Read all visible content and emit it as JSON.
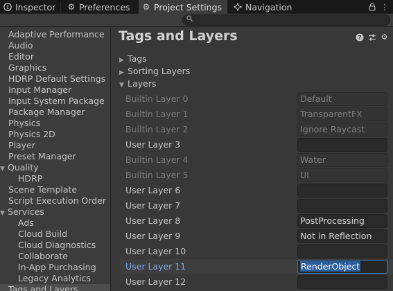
{
  "tabs": [
    {
      "label": "Inspector",
      "icon": "info-icon",
      "active": false
    },
    {
      "label": "Preferences",
      "icon": "gear-icon",
      "active": false
    },
    {
      "label": "Project Settings",
      "icon": "gear-icon",
      "active": true
    },
    {
      "label": "Navigation",
      "icon": "navigation-icon",
      "active": false
    }
  ],
  "window_controls": {
    "menu_glyph": "⋮",
    "lock_glyph": "🔒"
  },
  "search": {
    "value": "",
    "placeholder": ""
  },
  "sidebar": {
    "items": [
      {
        "label": "Adaptive Performance"
      },
      {
        "label": "Audio"
      },
      {
        "label": "Editor"
      },
      {
        "label": "Graphics"
      },
      {
        "label": "HDRP Default Settings"
      },
      {
        "label": "Input Manager"
      },
      {
        "label": "Input System Package"
      },
      {
        "label": "Package Manager"
      },
      {
        "label": "Physics"
      },
      {
        "label": "Physics 2D"
      },
      {
        "label": "Player"
      },
      {
        "label": "Preset Manager"
      },
      {
        "label": "Quality",
        "expanded": true
      },
      {
        "label": "HDRP",
        "indent": 1
      },
      {
        "label": "Scene Template"
      },
      {
        "label": "Script Execution Order"
      },
      {
        "label": "Services",
        "expanded": true
      },
      {
        "label": "Ads",
        "indent": 1
      },
      {
        "label": "Cloud Build",
        "indent": 1
      },
      {
        "label": "Cloud Diagnostics",
        "indent": 1
      },
      {
        "label": "Collaborate",
        "indent": 1
      },
      {
        "label": "In-App Purchasing",
        "indent": 1
      },
      {
        "label": "Legacy Analytics",
        "indent": 1
      },
      {
        "label": "Tags and Layers",
        "selected": true
      }
    ]
  },
  "main": {
    "title": "Tags and Layers",
    "header_icons": [
      "help-icon",
      "presets-icon",
      "settings-icon"
    ],
    "foldouts": [
      {
        "label": "Tags",
        "expanded": false
      },
      {
        "label": "Sorting Layers",
        "expanded": false
      },
      {
        "label": "Layers",
        "expanded": true
      }
    ],
    "layers": [
      {
        "label": "Builtin Layer 0",
        "value": "Default",
        "builtin": true
      },
      {
        "label": "Builtin Layer 1",
        "value": "TransparentFX",
        "builtin": true
      },
      {
        "label": "Builtin Layer 2",
        "value": "Ignore Raycast",
        "builtin": true
      },
      {
        "label": "User Layer 3",
        "value": "",
        "builtin": false
      },
      {
        "label": "Builtin Layer 4",
        "value": "Water",
        "builtin": true
      },
      {
        "label": "Builtin Layer 5",
        "value": "UI",
        "builtin": true
      },
      {
        "label": "User Layer 6",
        "value": "",
        "builtin": false
      },
      {
        "label": "User Layer 7",
        "value": "",
        "builtin": false
      },
      {
        "label": "User Layer 8",
        "value": "PostProcessing",
        "builtin": false
      },
      {
        "label": "User Layer 9",
        "value": "Not in Reflection",
        "builtin": false
      },
      {
        "label": "User Layer 10",
        "value": "",
        "builtin": false
      },
      {
        "label": "User Layer 11",
        "value": "RenderObject",
        "builtin": false,
        "selected": true
      },
      {
        "label": "User Layer 12",
        "value": "",
        "builtin": false
      }
    ]
  },
  "colors": {
    "accent": "#2b5e9c",
    "selected_label": "#7ba9e6",
    "background": "#383838"
  }
}
